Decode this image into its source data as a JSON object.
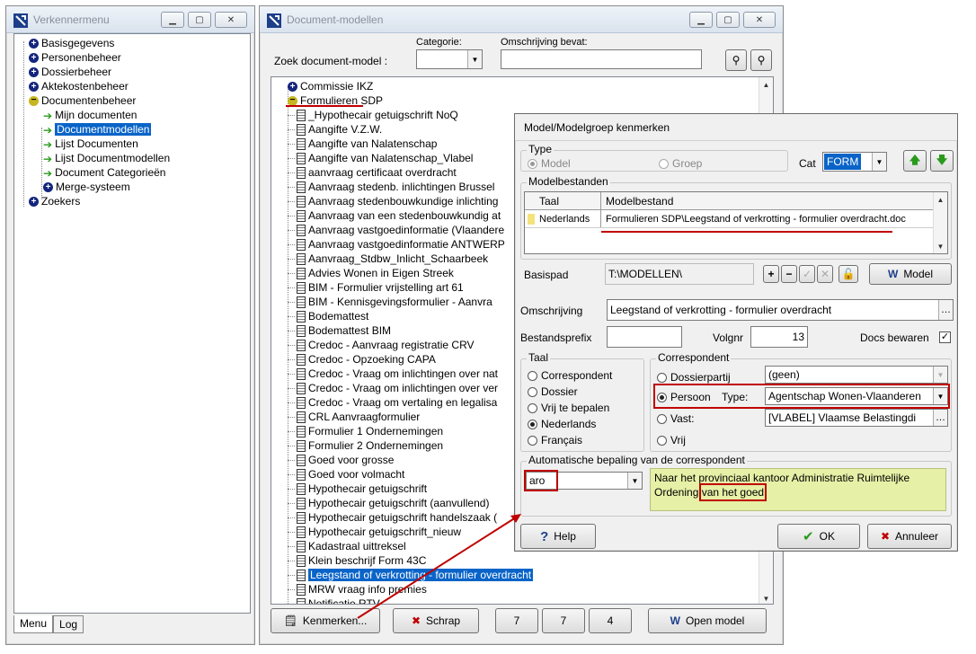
{
  "verkenner": {
    "title": "Verkennermenu",
    "items": [
      {
        "label": "Basisgegevens"
      },
      {
        "label": "Personenbeheer"
      },
      {
        "label": "Dossierbeheer"
      },
      {
        "label": "Aktekostenbeheer"
      },
      {
        "label": "Documentenbeheer"
      },
      {
        "label": "Mijn documenten"
      },
      {
        "label": "Documentmodellen"
      },
      {
        "label": "Lijst Documenten"
      },
      {
        "label": "Lijst Documentmodellen"
      },
      {
        "label": "Document Categorieën"
      },
      {
        "label": "Merge-systeem"
      },
      {
        "label": "Zoekers"
      }
    ],
    "tabs": [
      "Menu",
      "Log"
    ]
  },
  "docmodel": {
    "title": "Document-modellen",
    "zoek_label": "Zoek document-model :",
    "categorie_label": "Categorie:",
    "omschrijving_label": "Omschrijving bevat:",
    "root_items": [
      "Commissie IKZ",
      "Formulieren SDP"
    ],
    "docs": [
      "_Hypothecair getuigschrift NoQ",
      "Aangifte V.Z.W.",
      "Aangifte van Nalatenschap",
      "Aangifte van Nalatenschap_Vlabel",
      "aanvraag certificaat overdracht",
      "Aanvraag stedenb. inlichtingen Brussel",
      "Aanvraag stedenbouwkundige inlichting",
      "Aanvraag van een stedenbouwkundig at",
      "Aanvraag vastgoedinformatie (Vlaandere",
      "Aanvraag vastgoedinformatie ANTWERP",
      "Aanvraag_Stdbw_Inlicht_Schaarbeek",
      "Advies Wonen in Eigen Streek",
      "BIM - Formulier vrijstelling art 61",
      "BIM - Kennisgevingsformulier - Aanvra",
      "Bodemattest",
      "Bodemattest BIM",
      "Credoc - Aanvraag registratie CRV",
      "Credoc - Opzoeking CAPA",
      "Credoc - Vraag om inlichtingen over nat",
      "Credoc - Vraag om inlichtingen over ver",
      "Credoc - Vraag om vertaling en legalisa",
      "CRL Aanvraagformulier",
      "Formulier 1 Ondernemingen",
      "Formulier 2 Ondernemingen",
      "Goed voor grosse",
      "Goed voor volmacht",
      "Hypothecair getuigschrift",
      "Hypothecair getuigschrift (aanvullend)",
      "Hypothecair getuigschrift handelszaak (",
      "Hypothecair getuigschrift_nieuw",
      "Kadastraal uittreksel",
      "Klein beschrijf Form 43C",
      "Leegstand of verkrotting - formulier overdracht",
      "MRW vraag info premies",
      "Notificatie RTV"
    ],
    "buttons": {
      "kenmerken": "Kenmerken...",
      "schrap": "Schrap",
      "count1": "7",
      "count2": "7",
      "count3": "4",
      "open": "Open model"
    }
  },
  "dialog": {
    "title": "Model/Modelgroep kenmerken",
    "type_label": "Type",
    "type_model": "Model",
    "type_groep": "Groep",
    "cat_label": "Cat",
    "cat_value": "FORM",
    "modelbestanden_label": "Modelbestanden",
    "col_taal": "Taal",
    "col_modelbestand": "Modelbestand",
    "row_taal": "Nederlands",
    "row_bestand": "Formulieren SDP\\Leegstand of verkrotting - formulier overdracht.doc",
    "basispad_label": "Basispad",
    "basispad_value": "T:\\MODELLEN\\",
    "model_button": "Model",
    "omschrijving_label": "Omschrijving",
    "omschrijving_value": "Leegstand of verkrotting - formulier overdracht",
    "bestandsprefix_label": "Bestandsprefix",
    "bestandsprefix_value": "",
    "volgnr_label": "Volgnr",
    "volgnr_value": "13",
    "docs_bewaren_label": "Docs bewaren",
    "taal_group": "Taal",
    "taal_options": [
      "Correspondent",
      "Dossier",
      "Vrij te bepalen",
      "Nederlands",
      "Français"
    ],
    "corr_group": "Correspondent",
    "corr_dossierpartij": "Dossierpartij",
    "corr_dossierpartij_value": "(geen)",
    "corr_persoon": "Persoon",
    "corr_type_label": "Type:",
    "corr_type_value": "Agentschap Wonen-Vlaanderen",
    "corr_vast": "Vast:",
    "corr_vast_value": "[VLABEL] Vlaamse Belastingdi",
    "corr_vrij": "Vrij",
    "auto_group": "Automatische bepaling van de correspondent",
    "auto_value": "aro",
    "auto_text_1": "Naar het provinciaal kantoor Administratie Ruimtelijke",
    "auto_text_2": "Ordening ",
    "auto_text_3": "van het goed",
    "auto_text_4": ".",
    "help_button": "Help",
    "ok_button": "OK",
    "annuleer_button": "Annuleer"
  }
}
